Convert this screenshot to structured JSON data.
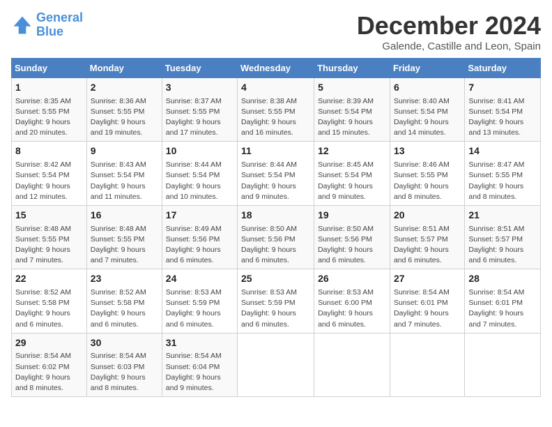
{
  "logo": {
    "line1": "General",
    "line2": "Blue"
  },
  "title": "December 2024",
  "subtitle": "Galende, Castille and Leon, Spain",
  "header": {
    "save_label": "December 2024",
    "location": "Galende, Castille and Leon, Spain"
  },
  "days_of_week": [
    "Sunday",
    "Monday",
    "Tuesday",
    "Wednesday",
    "Thursday",
    "Friday",
    "Saturday"
  ],
  "weeks": [
    [
      {
        "day": 1,
        "sunrise": "8:35 AM",
        "sunset": "5:55 PM",
        "daylight": "9 hours and 20 minutes."
      },
      {
        "day": 2,
        "sunrise": "8:36 AM",
        "sunset": "5:55 PM",
        "daylight": "9 hours and 19 minutes."
      },
      {
        "day": 3,
        "sunrise": "8:37 AM",
        "sunset": "5:55 PM",
        "daylight": "9 hours and 17 minutes."
      },
      {
        "day": 4,
        "sunrise": "8:38 AM",
        "sunset": "5:55 PM",
        "daylight": "9 hours and 16 minutes."
      },
      {
        "day": 5,
        "sunrise": "8:39 AM",
        "sunset": "5:54 PM",
        "daylight": "9 hours and 15 minutes."
      },
      {
        "day": 6,
        "sunrise": "8:40 AM",
        "sunset": "5:54 PM",
        "daylight": "9 hours and 14 minutes."
      },
      {
        "day": 7,
        "sunrise": "8:41 AM",
        "sunset": "5:54 PM",
        "daylight": "9 hours and 13 minutes."
      }
    ],
    [
      {
        "day": 8,
        "sunrise": "8:42 AM",
        "sunset": "5:54 PM",
        "daylight": "9 hours and 12 minutes."
      },
      {
        "day": 9,
        "sunrise": "8:43 AM",
        "sunset": "5:54 PM",
        "daylight": "9 hours and 11 minutes."
      },
      {
        "day": 10,
        "sunrise": "8:44 AM",
        "sunset": "5:54 PM",
        "daylight": "9 hours and 10 minutes."
      },
      {
        "day": 11,
        "sunrise": "8:44 AM",
        "sunset": "5:54 PM",
        "daylight": "9 hours and 9 minutes."
      },
      {
        "day": 12,
        "sunrise": "8:45 AM",
        "sunset": "5:54 PM",
        "daylight": "9 hours and 9 minutes."
      },
      {
        "day": 13,
        "sunrise": "8:46 AM",
        "sunset": "5:55 PM",
        "daylight": "9 hours and 8 minutes."
      },
      {
        "day": 14,
        "sunrise": "8:47 AM",
        "sunset": "5:55 PM",
        "daylight": "9 hours and 8 minutes."
      }
    ],
    [
      {
        "day": 15,
        "sunrise": "8:48 AM",
        "sunset": "5:55 PM",
        "daylight": "9 hours and 7 minutes."
      },
      {
        "day": 16,
        "sunrise": "8:48 AM",
        "sunset": "5:55 PM",
        "daylight": "9 hours and 7 minutes."
      },
      {
        "day": 17,
        "sunrise": "8:49 AM",
        "sunset": "5:56 PM",
        "daylight": "9 hours and 6 minutes."
      },
      {
        "day": 18,
        "sunrise": "8:50 AM",
        "sunset": "5:56 PM",
        "daylight": "9 hours and 6 minutes."
      },
      {
        "day": 19,
        "sunrise": "8:50 AM",
        "sunset": "5:56 PM",
        "daylight": "9 hours and 6 minutes."
      },
      {
        "day": 20,
        "sunrise": "8:51 AM",
        "sunset": "5:57 PM",
        "daylight": "9 hours and 6 minutes."
      },
      {
        "day": 21,
        "sunrise": "8:51 AM",
        "sunset": "5:57 PM",
        "daylight": "9 hours and 6 minutes."
      }
    ],
    [
      {
        "day": 22,
        "sunrise": "8:52 AM",
        "sunset": "5:58 PM",
        "daylight": "9 hours and 6 minutes."
      },
      {
        "day": 23,
        "sunrise": "8:52 AM",
        "sunset": "5:58 PM",
        "daylight": "9 hours and 6 minutes."
      },
      {
        "day": 24,
        "sunrise": "8:53 AM",
        "sunset": "5:59 PM",
        "daylight": "9 hours and 6 minutes."
      },
      {
        "day": 25,
        "sunrise": "8:53 AM",
        "sunset": "5:59 PM",
        "daylight": "9 hours and 6 minutes."
      },
      {
        "day": 26,
        "sunrise": "8:53 AM",
        "sunset": "6:00 PM",
        "daylight": "9 hours and 6 minutes."
      },
      {
        "day": 27,
        "sunrise": "8:54 AM",
        "sunset": "6:01 PM",
        "daylight": "9 hours and 7 minutes."
      },
      {
        "day": 28,
        "sunrise": "8:54 AM",
        "sunset": "6:01 PM",
        "daylight": "9 hours and 7 minutes."
      }
    ],
    [
      {
        "day": 29,
        "sunrise": "8:54 AM",
        "sunset": "6:02 PM",
        "daylight": "9 hours and 8 minutes."
      },
      {
        "day": 30,
        "sunrise": "8:54 AM",
        "sunset": "6:03 PM",
        "daylight": "9 hours and 8 minutes."
      },
      {
        "day": 31,
        "sunrise": "8:54 AM",
        "sunset": "6:04 PM",
        "daylight": "9 hours and 9 minutes."
      },
      null,
      null,
      null,
      null
    ]
  ]
}
